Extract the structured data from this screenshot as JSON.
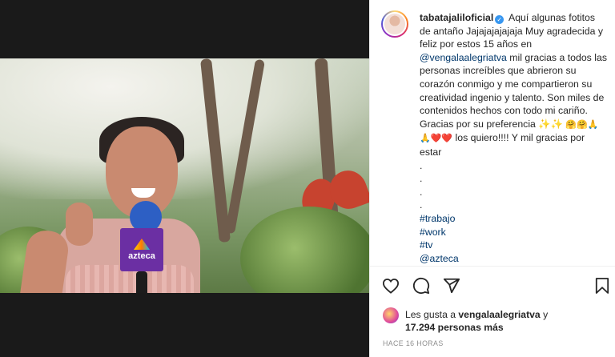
{
  "post": {
    "username": "tabatajaliloficial",
    "caption_lines": [
      "Aquí algunas fotitos",
      "de antaño Jajajajajajaja Muy agradecida",
      "y feliz por estos 15 años en"
    ],
    "mention_venga": "@vengalaalegriatva",
    "caption_after_mention": " mil gracias a todos las personas increíbles que abrieron su corazón conmigo y me compartieron su creatividad ingenio y talento. Son miles de contenidos hechos con todo mi cariño. Gracias por su preferencia ✨✨",
    "caption_emojis_line": "🤗🤗🙏🙏❤️❤️",
    "caption_love": " los quiero!!!! Y mil gracias por estar",
    "dots": [
      ".",
      ".",
      ".",
      "."
    ],
    "hashtags": [
      "#trabajo",
      "#work",
      "#tv"
    ],
    "mention_azteca": "@azteca"
  },
  "media": {
    "mic_label": "azteca"
  },
  "likes": {
    "prefix": "Les gusta a ",
    "user": "vengalaalegriatva",
    "mid": " y",
    "count": "17.294 personas más"
  },
  "timestamp": "HACE 16 HORAS",
  "icons": [
    "heart-icon",
    "comment-icon",
    "share-icon",
    "bookmark-icon"
  ]
}
